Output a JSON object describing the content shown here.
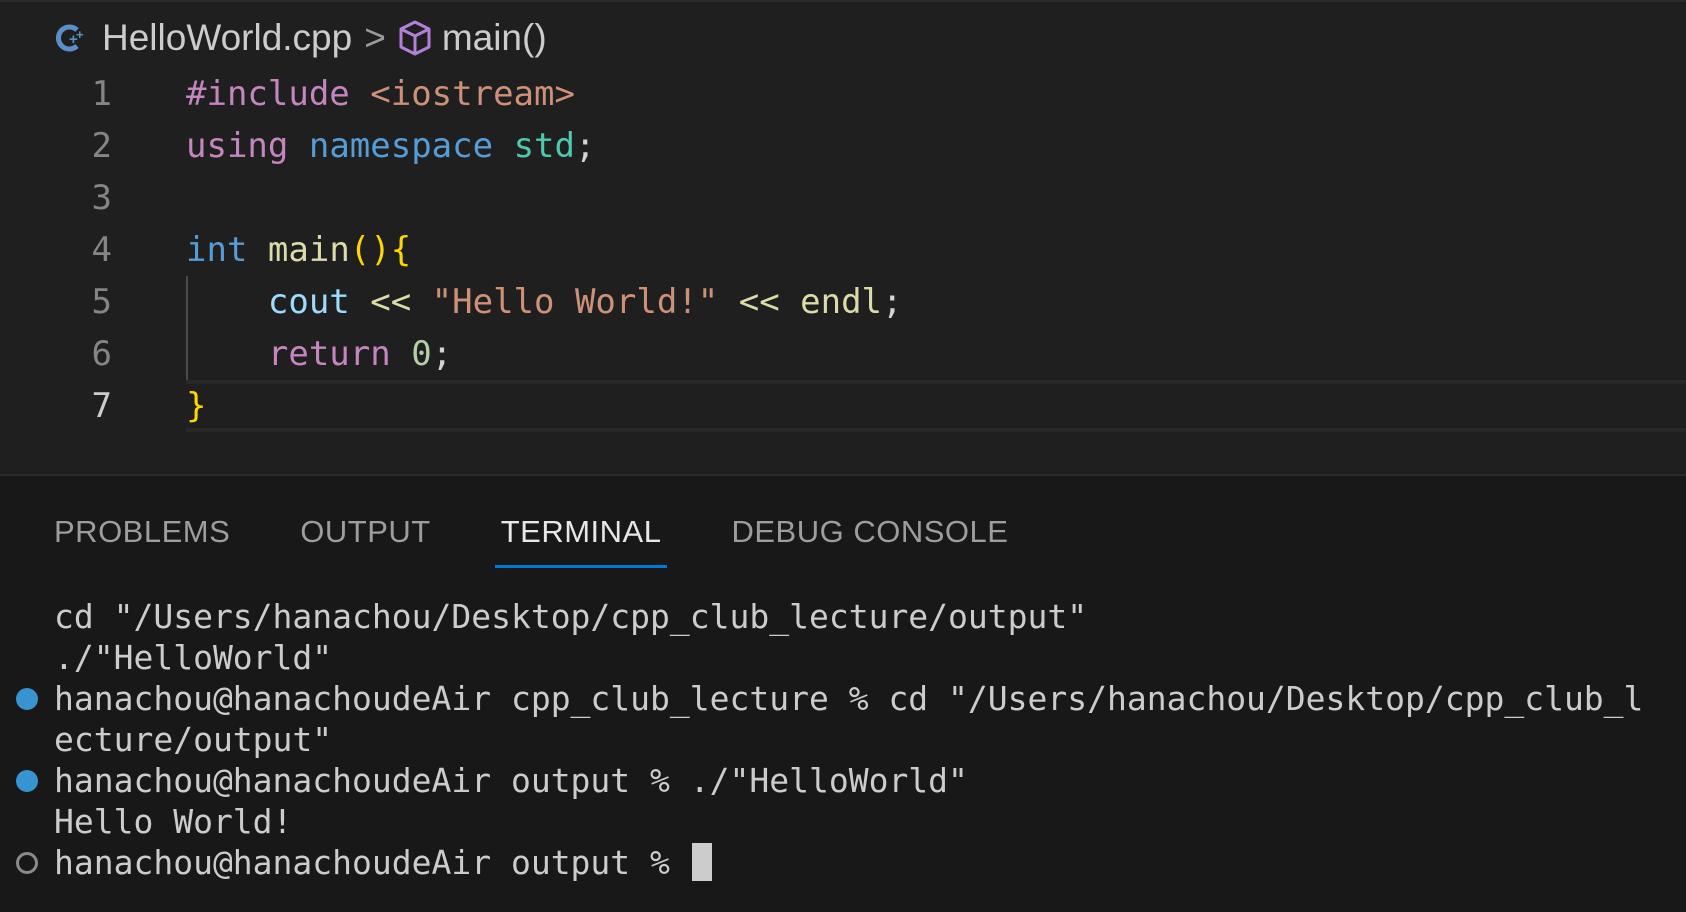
{
  "breadcrumb": {
    "file": "HelloWorld.cpp",
    "separator": ">",
    "symbol": "main()"
  },
  "code_lines": [
    {
      "n": "1",
      "tokens": [
        [
          "#include",
          "t-pre"
        ],
        [
          " ",
          "t-plain"
        ],
        [
          "<iostream>",
          "t-inc"
        ]
      ]
    },
    {
      "n": "2",
      "tokens": [
        [
          "using",
          "t-kw"
        ],
        [
          " ",
          "t-plain"
        ],
        [
          "namespace",
          "t-kw2"
        ],
        [
          " ",
          "t-plain"
        ],
        [
          "std",
          "t-type"
        ],
        [
          ";",
          "t-plain"
        ]
      ]
    },
    {
      "n": "3",
      "tokens": []
    },
    {
      "n": "4",
      "tokens": [
        [
          "int",
          "t-kw2"
        ],
        [
          " ",
          "t-plain"
        ],
        [
          "main",
          "t-fn"
        ],
        [
          "(){",
          "t-brace"
        ]
      ]
    },
    {
      "n": "5",
      "tokens": [
        [
          "    ",
          "t-plain"
        ],
        [
          "cout",
          "t-var"
        ],
        [
          " << ",
          "t-fn"
        ],
        [
          "\"Hello World!\"",
          "t-str"
        ],
        [
          " << ",
          "t-fn"
        ],
        [
          "endl",
          "t-fn"
        ],
        [
          ";",
          "t-plain"
        ]
      ]
    },
    {
      "n": "6",
      "tokens": [
        [
          "    ",
          "t-plain"
        ],
        [
          "return",
          "t-kw"
        ],
        [
          " ",
          "t-plain"
        ],
        [
          "0",
          "t-num"
        ],
        [
          ";",
          "t-plain"
        ]
      ]
    },
    {
      "n": "7",
      "tokens": [
        [
          "}",
          "t-brace"
        ]
      ],
      "active": true
    }
  ],
  "panel": {
    "tabs": [
      {
        "label": "PROBLEMS",
        "active": false
      },
      {
        "label": "OUTPUT",
        "active": false
      },
      {
        "label": "TERMINAL",
        "active": true
      },
      {
        "label": "DEBUG CONSOLE",
        "active": false
      }
    ]
  },
  "terminal": {
    "lines": [
      {
        "text": "cd \"/Users/hanachou/Desktop/cpp_club_lecture/output\"",
        "dot": "none"
      },
      {
        "text": "./\"HelloWorld\"",
        "dot": "none"
      },
      {
        "text": "hanachou@hanachoudeAir cpp_club_lecture % cd \"/Users/hanachou/Desktop/cpp_club_l",
        "dot": "filled"
      },
      {
        "text": "ecture/output\"",
        "dot": "none"
      },
      {
        "text": "hanachou@hanachoudeAir output % ./\"HelloWorld\"",
        "dot": "filled"
      },
      {
        "text": "Hello World!",
        "dot": "none"
      },
      {
        "text": "hanachou@hanachoudeAir output % ",
        "dot": "hollow",
        "cursor": true
      }
    ]
  },
  "colors": {
    "accent": "#0078d4",
    "dot_filled": "#3794d1",
    "cpp_icon": "#5c8fc9",
    "symbol_icon": "#b180d7"
  },
  "icons": {
    "file": "cpp-file-icon",
    "symbol": "cube-method-icon"
  }
}
